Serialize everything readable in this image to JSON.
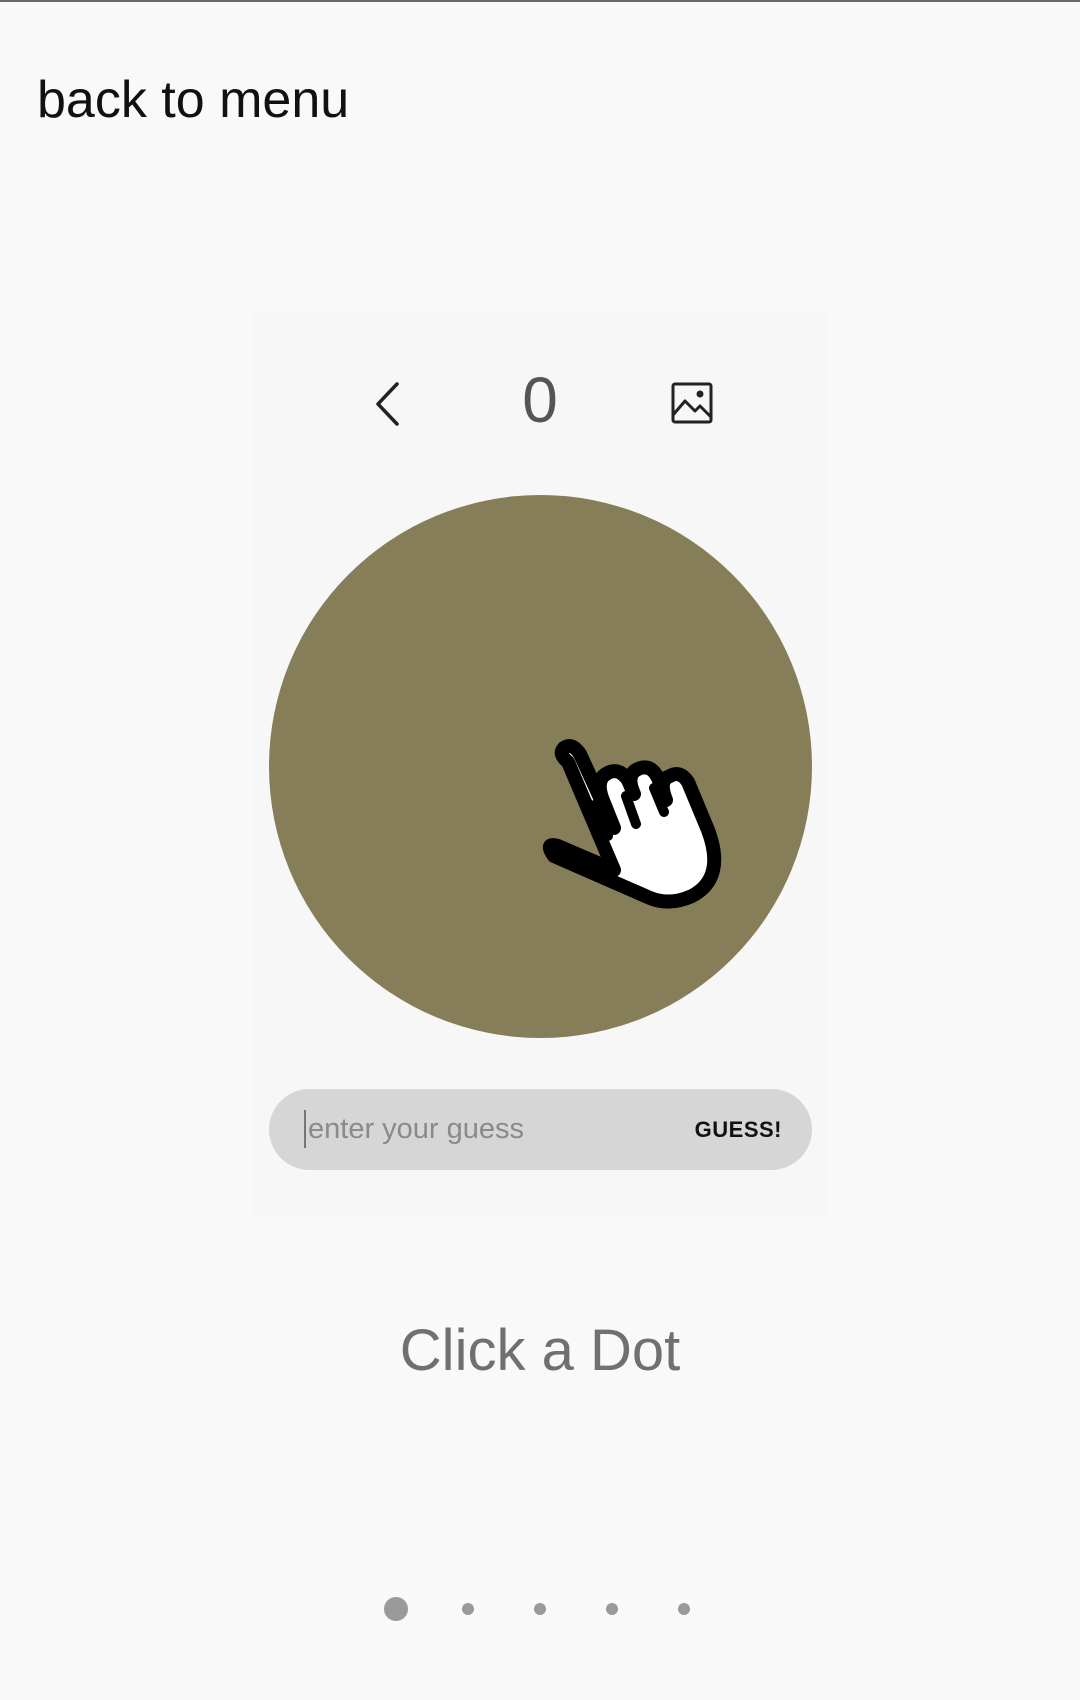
{
  "header": {
    "back_label": "back to menu"
  },
  "game": {
    "counter": "0",
    "dot_color": "#857e58",
    "guess_placeholder": "enter your guess",
    "guess_value": "",
    "guess_button_label": "GUESS!",
    "instruction": "Click a Dot"
  },
  "pager": {
    "total_pages": 5,
    "active_index": 0
  }
}
